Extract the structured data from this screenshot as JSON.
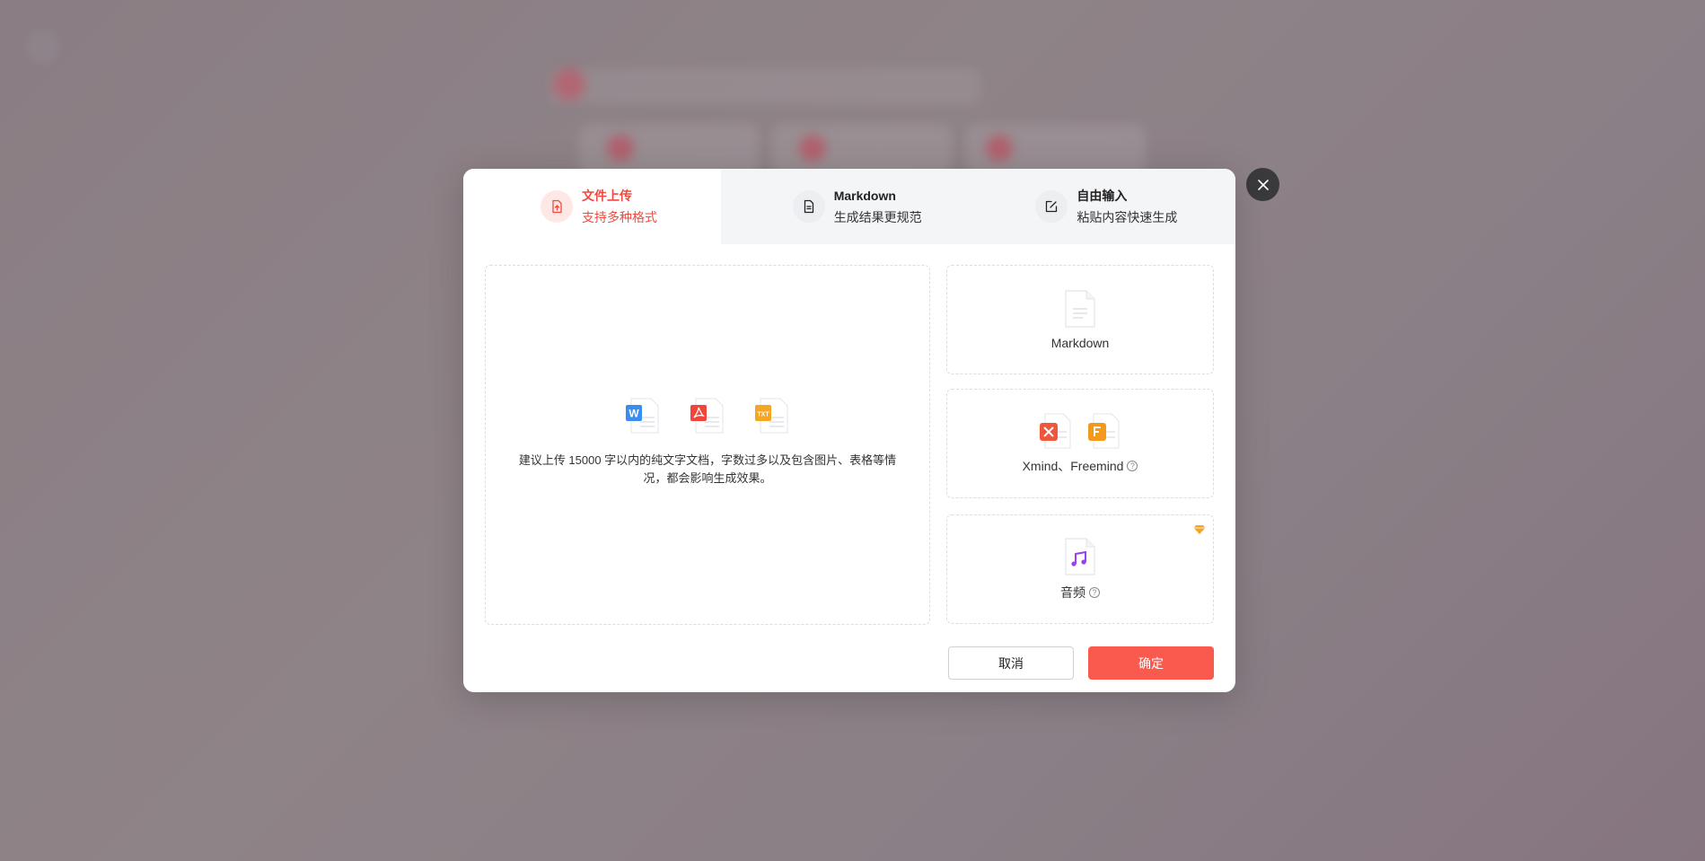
{
  "tabs": [
    {
      "title": "文件上传",
      "subtitle": "支持多种格式",
      "icon": "file-upload-icon",
      "active": true
    },
    {
      "title": "Markdown",
      "subtitle": "生成结果更规范",
      "icon": "document-icon",
      "active": false
    },
    {
      "title": "自由输入",
      "subtitle": "粘贴内容快速生成",
      "icon": "edit-icon",
      "active": false
    }
  ],
  "upload": {
    "file_types": [
      "W",
      "PDF",
      "TXT"
    ],
    "hint": "建议上传 15000 字以内的纯文字文档，字数过多以及包含图片、表格等情况，都会影响生成效果。"
  },
  "side_options": {
    "markdown": {
      "label": "Markdown"
    },
    "mindmap": {
      "label": "Xmind、Freemind",
      "help": "?"
    },
    "audio": {
      "label": "音频",
      "help": "?"
    }
  },
  "buttons": {
    "cancel": "取消",
    "confirm": "确定"
  },
  "colors": {
    "accent": "#f95a4d",
    "active_tab_text": "#ef4a3f",
    "close_bg": "#3a3a3c"
  }
}
